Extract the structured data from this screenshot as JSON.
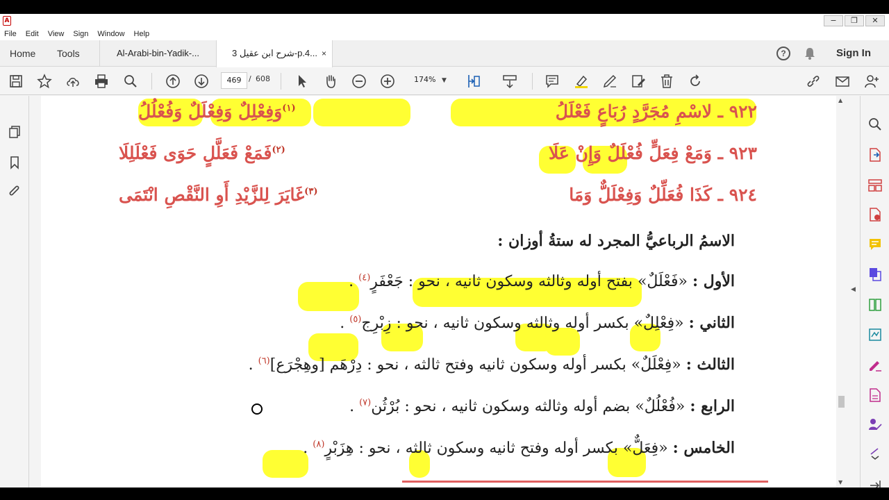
{
  "menubar": {
    "items": [
      "File",
      "Edit",
      "View",
      "Sign",
      "Window",
      "Help"
    ]
  },
  "tabs": {
    "home": "Home",
    "tools": "Tools",
    "doc1": "Al-Arabi-bin-Yadik-...",
    "doc2": "شرح ابن عقيل 3-p.4...",
    "close": "×"
  },
  "header": {
    "sign_in": "Sign In",
    "help": "?"
  },
  "toolbar": {
    "page_current": "469",
    "page_sep": "/",
    "page_total": "608",
    "zoom": "174%"
  },
  "verses": [
    {
      "num": "٩٢٢",
      "right": "لاسْمِ مُجَرَّدٍ رُبَاعٍ فَعْلَلُ",
      "left": "وَفِعْلِلٌ وَفِعْلَلٌ وَفُعْلُلُ",
      "fn": "(١)"
    },
    {
      "num": "٩٢٣",
      "right": "وَمَعْ فِعَلٍّ فُعْلَلٌ وَإِنْ عَلَا",
      "left": "فَمَعْ فَعَلَّلٍ حَوَى فَعْلَلِلَا",
      "fn": "(٢)"
    },
    {
      "num": "٩٢٤",
      "right": "كَذَا فُعَلِّلٌ وَفِعْلَلٌّ وَمَا",
      "left": "غَايَرَ لِلزَّيْدِ أَوِ النَّقْصِ انْتَمَى",
      "fn": "(٣)"
    }
  ],
  "commentary": {
    "heading": "الاسمُ الرباعيُّ المجرد له ستةُ أوزان :",
    "items": [
      {
        "label": "الأول :",
        "pattern": "«فَعْلَلٌ»",
        "desc": "بفتح أوله وثالثه وسكون ثانيه ، نحو :",
        "example": "جَعْفَرٍ",
        "fn": "(٤)"
      },
      {
        "label": "الثاني :",
        "pattern": "«فِعْلِلٌ»",
        "desc": "بكسر أوله وثالثه وسكون ثانيه ، نحو :",
        "example": "زِبْرِج",
        "fn": "(٥)"
      },
      {
        "label": "الثالث :",
        "pattern": "«فِعْلَلٌ»",
        "desc": "بكسر أوله وسكون ثانيه وفتح ثالثه ، نحو :",
        "example": "دِرْهَم [وهِجْرَع]",
        "fn": "(٦)"
      },
      {
        "label": "الرابع :",
        "pattern": "«فُعْلُلٌ»",
        "desc": "بضم أوله وثالثه وسكون ثانيه ، نحو :",
        "example": "بُرْثُن",
        "fn": "(٧)"
      },
      {
        "label": "الخامس :",
        "pattern": "«فِعَلٌّ»",
        "desc": "بكسر أوله وفتح ثانيه وسكون ثالثه ، نحو :",
        "example": "هِزَبْرٍ",
        "fn": "(٨)"
      }
    ],
    "end": "."
  },
  "colors": {
    "verse_red": "#d9534f",
    "highlight": "#ffff33",
    "footnote": "#c0392b"
  }
}
